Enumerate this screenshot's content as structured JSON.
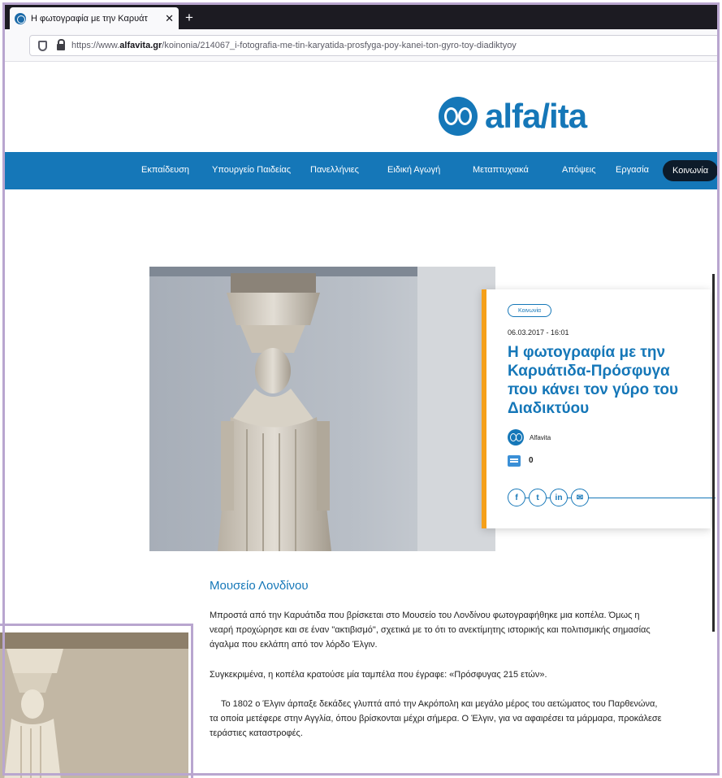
{
  "browser": {
    "tab_title": "Η φωτογραφία με την Καρυάτ",
    "tab_close": "✕",
    "new_tab": "+",
    "url_prefix": "https://www.",
    "url_domain": "alfavita.gr",
    "url_path": "/koinonia/214067_i-fotografia-me-tin-karyatida-prosfyga-poy-kanei-ton-gyro-toy-diadiktyoy"
  },
  "site": {
    "logo_text": "alfa/ita",
    "nav": [
      "Εκπαίδευση",
      "Υπουργείο Παιδείας",
      "Πανελλήνιες",
      "Ειδική Αγωγή",
      "Μεταπτυχιακά",
      "Απόψεις",
      "Εργασία"
    ],
    "nav_active": "Κοινωνία"
  },
  "card": {
    "category": "Κοινωνία",
    "date": "06.03.2017 - 16:01",
    "title": "Η φωτογραφία με την Καρυάτιδα-Πρόσφυγα που κάνει τον γύρο του Διαδικτύου",
    "author": "Alfavita",
    "comments": "0",
    "share": [
      "f",
      "t",
      "in",
      "✉"
    ]
  },
  "article": {
    "subhead": "Μουσείο Λονδίνου",
    "p1": "Μπροστά από την Καρυάτιδα που βρίσκεται στο Μουσείο του Λονδίνου φωτογραφήθηκε μια κοπέλα. Όμως η νεαρή προχώρησε και σε έναν \"ακτιβισμό\", σχετικά με το ότι το ανεκτίμητης ιστορικής και πολιτισμικής σημασίας άγαλμα που εκλάπη από τον λόρδο Έλγιν.",
    "p2": "Συγκεκριμένα, η κοπέλα κρατούσε μία ταμπέλα που έγραφε: «Πρόσφυγας 215 ετών».",
    "p3": "Το 1802 ο Έλγιν άρπαξε δεκάδες γλυπτά από την Ακρόπολη και μεγάλο μέρος του αετώματος του Παρθενώνα, τα οποία μετέφερε στην Αγγλία, όπου βρίσκονται μέχρι σήμερα. Ο Έλγιν, για να αφαιρέσει τα μάρμαρα, προκάλεσε τεράστιες καταστροφές."
  },
  "colors": {
    "brand": "#1577b8",
    "accent": "#f5a01a",
    "frame": "#b9a6cf"
  }
}
